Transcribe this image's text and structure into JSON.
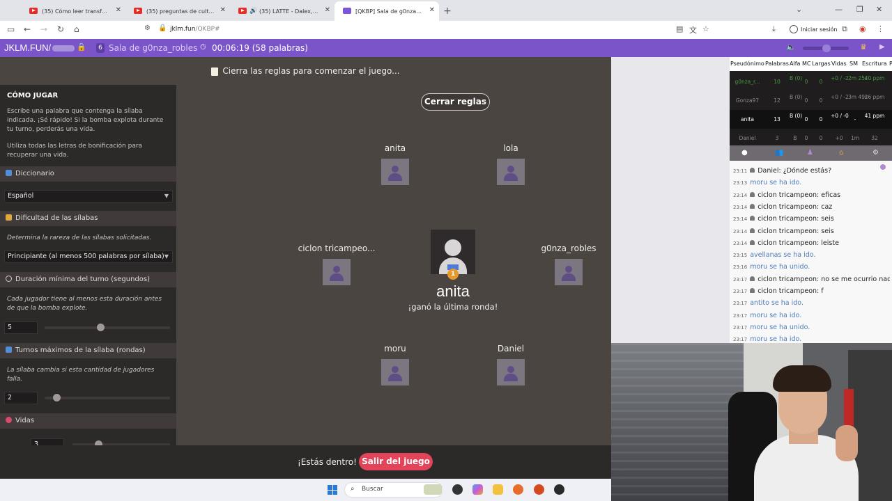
{
  "browser": {
    "tabs": [
      {
        "label": "(35) Cómo leer transforma el ce",
        "icon": "youtube-icon"
      },
      {
        "label": "(35) preguntas de cultura y min",
        "icon": "youtube-icon"
      },
      {
        "label": "(35) LATTE - Dalex, Lenny Ta",
        "icon": "youtube-icon",
        "audio": "speaker-icon"
      },
      {
        "label": "[QKBP] Sala de g0nza_robles",
        "icon": "jklm-icon"
      }
    ],
    "address_host": "jklm.fun",
    "address_path": "/QKBP#",
    "signin_label": "Iniciar sesión"
  },
  "topbar": {
    "brand": "JKLM.FUN/",
    "player_count": "6",
    "room_title": "Sala de g0nza_robles",
    "timer": "00:06:19 (58 palabras)",
    "volume_level": 0.45,
    "accent_color": "#7a54c8"
  },
  "game": {
    "rules_banner": "Cierra las reglas para comenzar el juego...",
    "close_rules_label": "Cerrar reglas",
    "players": [
      "anita",
      "lola",
      "ciclon tricampeo...",
      "g0nza_robles",
      "moru",
      "Daniel"
    ],
    "winner": {
      "name": "anita",
      "message": "¡ganó la última ronda!",
      "medal": "1"
    },
    "in_text": "¡Estás dentro!",
    "leave_label": "Salir del juego"
  },
  "rules": {
    "title": "CÓMO JUGAR",
    "paragraph1": "Escribe una palabra que contenga la sílaba indicada. ¡Sé rápido! Si la bomba explota durante tu turno, perderás una vida.",
    "paragraph2": "Utiliza todas las letras de bonificación para recuperar una vida.",
    "dictionary_label": "Diccionario",
    "dictionary_value": "Español",
    "difficulty_label": "Dificultad de las sílabas",
    "difficulty_desc": "Determina la rareza de las sílabas solicitadas.",
    "difficulty_value": "Principiante (al menos 500 palabras por sílaba)",
    "duration_label": "Duración mínima del turno (segundos)",
    "duration_desc": "Cada jugador tiene al menos esta duración antes de que la bomba explote.",
    "duration_value": "5",
    "turns_label": "Turnos máximos de la sílaba (rondas)",
    "turns_desc": "La sílaba cambia si esta cantidad de jugadores falla.",
    "turns_value": "2",
    "lives_label": "Vidas",
    "lives_value": "3"
  },
  "stats": {
    "headers": [
      "Pseudónimo",
      "Palabras",
      "Alfa",
      "MC",
      "Largas",
      "Vidas",
      "SM",
      "Escritura",
      "P"
    ],
    "rows": [
      {
        "name": "g0nza_r...",
        "words": "10",
        "alfa": "B (0)",
        "mc": "0",
        "largas": "0",
        "vidas": "+0 / -2",
        "sm": "2m 25s",
        "escritura": "40 ppm",
        "style": "green"
      },
      {
        "name": "Gonza97",
        "words": "12",
        "alfa": "B (0)",
        "mc": "0",
        "largas": "0",
        "vidas": "+0 / -2",
        "sm": "3m 49s",
        "escritura": "26 ppm",
        "style": "dim"
      },
      {
        "name": "anita",
        "words": "13",
        "alfa": "B (0)",
        "mc": "0",
        "largas": "0",
        "vidas": "+0 / -0",
        "sm": "-",
        "escritura": "41 ppm",
        "style": "me"
      },
      {
        "name": "Daniel",
        "words": "3",
        "alfa": "B",
        "mc": "0",
        "largas": "0",
        "vidas": "+0",
        "sm": "1m",
        "escritura": "32",
        "style": "dim"
      }
    ]
  },
  "sidebar_tabs": [
    "chat-icon",
    "players-icon",
    "trophy-icon",
    "house-icon",
    "settings-icon"
  ],
  "chat": [
    {
      "time": "23:11",
      "user": "Daniel",
      "text": ": ¿Dónde estás?",
      "sys": false
    },
    {
      "time": "23:13",
      "user": "",
      "text": "moru se ha ido.",
      "sys": true
    },
    {
      "time": "23:14",
      "user": "ciclon tricampeon",
      "text": ": eficas",
      "sys": false
    },
    {
      "time": "23:14",
      "user": "ciclon tricampeon",
      "text": ": caz",
      "sys": false
    },
    {
      "time": "23:14",
      "user": "ciclon tricampeon",
      "text": ": seis",
      "sys": false
    },
    {
      "time": "23:14",
      "user": "ciclon tricampeon",
      "text": ": seis",
      "sys": false
    },
    {
      "time": "23:14",
      "user": "ciclon tricampeon",
      "text": ": leiste",
      "sys": false
    },
    {
      "time": "23:15",
      "user": "",
      "text": "avellanas se ha ido.",
      "sys": true
    },
    {
      "time": "23:16",
      "user": "",
      "text": "moru se ha unido.",
      "sys": true
    },
    {
      "time": "23:17",
      "user": "ciclon tricampeon",
      "text": ": no se me ocurrio nada",
      "sys": false
    },
    {
      "time": "23:17",
      "user": "ciclon tricampeon",
      "text": ": f",
      "sys": false
    },
    {
      "time": "23:17",
      "user": "",
      "text": "antito se ha ido.",
      "sys": true
    },
    {
      "time": "23:17",
      "user": "",
      "text": "moru se ha ido.",
      "sys": true
    },
    {
      "time": "23:17",
      "user": "",
      "text": "moru se ha unido.",
      "sys": true
    },
    {
      "time": "23:17",
      "user": "",
      "text": "moru se ha ido.",
      "sys": true
    }
  ],
  "taskbar": {
    "search_label": "Buscar"
  }
}
